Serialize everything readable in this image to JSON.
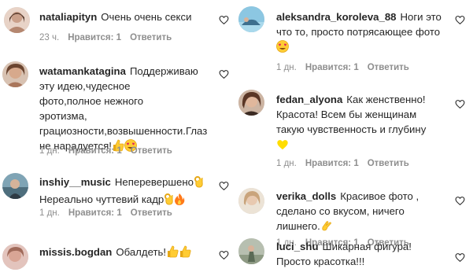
{
  "comments_left": [
    {
      "username": "nataliapityn",
      "text": "Очень очень секси",
      "time": "23 ч.",
      "likes": "Нравится: 1",
      "reply": "Ответить",
      "avatar_color": "#d9b7a6"
    },
    {
      "username": "watamankatagina",
      "text": "Поддерживаю эту идею,чудесное фото,полное нежного эротизма, грациозности,возвышенности.Глаз не нарадуется!",
      "emojis": [
        "thumbs-up-emoji",
        "heart-eyes-emoji"
      ],
      "time": "1 дн.",
      "likes": "Нравится: 1",
      "reply": "Ответить",
      "avatar_color": "#c69e86"
    },
    {
      "username": "inshiy__music",
      "text": "Неперевершено",
      "text2": "Нереально чуттевий кадр",
      "emojis": [
        "ok-hand-emoji",
        "ok-hand-emoji",
        "fire-emoji"
      ],
      "time": "1 дн.",
      "likes": "Нравится: 1",
      "reply": "Ответить",
      "avatar_color": "#6f8f9e"
    },
    {
      "username": "missis.bogdan",
      "text": "Обалдеть!",
      "emojis": [
        "thumbs-up-emoji",
        "thumbs-up-emoji"
      ],
      "avatar_color": "#d7a7a0"
    }
  ],
  "comments_right": [
    {
      "username": "aleksandra_koroleva_88",
      "text": "Ноги это что то, просто потрясающее фото",
      "emojis": [
        "heart-eyes-emoji"
      ],
      "time": "1 дн.",
      "likes": "Нравится: 1",
      "reply": "Ответить",
      "avatar_color": "#7fb9d6"
    },
    {
      "username": "fedan_alyona",
      "text": "Как женственно! Красота! Всем бы женщинам такую чувственность и глубину",
      "emojis": [
        "yellow-heart-emoji"
      ],
      "time": "1 дн.",
      "likes": "Нравится: 1",
      "reply": "Ответить",
      "avatar_color": "#9c7b6a"
    },
    {
      "username": "verika_dolls",
      "text": "Красивое фото , сделано со вкусом, ничего лишнего.",
      "emojis": [
        "clap-emoji"
      ],
      "time": "1 дн.",
      "likes": "Нравится: 1",
      "reply": "Ответить",
      "avatar_color": "#d9c7b0"
    },
    {
      "username": "luci_shu",
      "text": "Шикарная фигура! Просто красотка!!!",
      "avatar_color": "#9fa79a"
    }
  ],
  "colors": {
    "text": "#262626",
    "meta": "#8e8e8e",
    "heart_outline": "#262626"
  }
}
